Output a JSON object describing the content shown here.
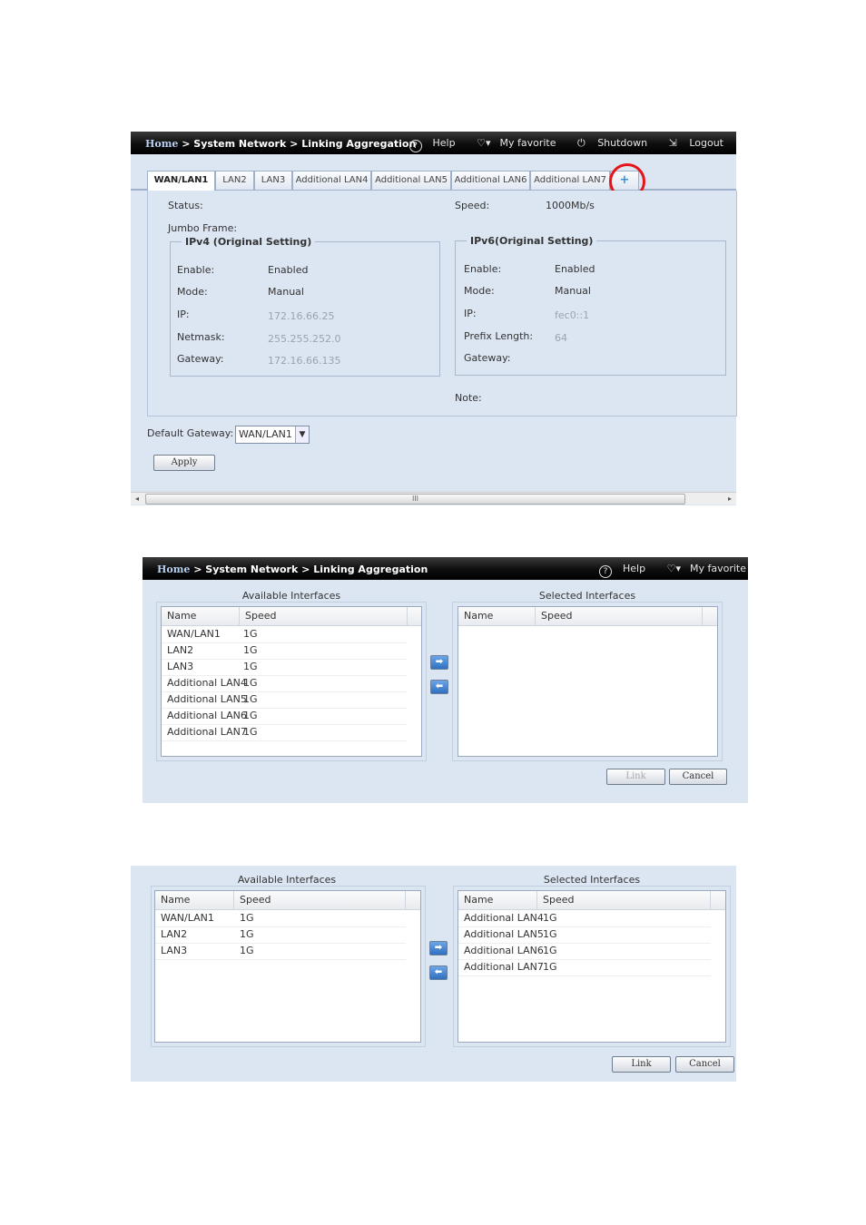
{
  "shot1": {
    "breadcrumb": {
      "home": "Home",
      "sep1": " > ",
      "section": "System Network",
      "sep2": " > ",
      "page": "Linking Aggregation"
    },
    "tools": {
      "help": "Help",
      "favorite": "My favorite",
      "shutdown": "Shutdown",
      "logout": "Logout"
    },
    "tabs": [
      "WAN/LAN1",
      "LAN2",
      "LAN3",
      "Additional LAN4",
      "Additional LAN5",
      "Additional LAN6",
      "Additional LAN7"
    ],
    "add_tab": "+",
    "status_label": "Status:",
    "speed_label": "Speed:",
    "speed_value": "1000Mb/s",
    "jumbo_label": "Jumbo Frame:",
    "ipv4": {
      "title": "IPv4 (Original Setting)",
      "enable_label": "Enable:",
      "enable_value": "Enabled",
      "mode_label": "Mode:",
      "mode_value": "Manual",
      "ip_label": "IP:",
      "ip_value": "172.16.66.25",
      "netmask_label": "Netmask:",
      "netmask_value": "255.255.252.0",
      "gateway_label": "Gateway:",
      "gateway_value": "172.16.66.135"
    },
    "ipv6": {
      "title": "IPv6(Original Setting)",
      "enable_label": "Enable:",
      "enable_value": "Enabled",
      "mode_label": "Mode:",
      "mode_value": "Manual",
      "ip_label": "IP:",
      "ip_value": "fec0::1",
      "prefix_label": "Prefix Length:",
      "prefix_value": "64",
      "gateway_label": "Gateway:"
    },
    "note_label": "Note:",
    "default_gateway_label": "Default Gateway:",
    "default_gateway_value": "WAN/LAN1",
    "apply": "Apply",
    "scroll_grip": "III"
  },
  "shot2": {
    "breadcrumb": {
      "home": "Home",
      "sep1": " > ",
      "section": "System Network",
      "sep2": " > ",
      "page": "Linking Aggregation"
    },
    "tools": {
      "help": "Help",
      "favorite": "My favorite"
    },
    "available_title": "Available Interfaces",
    "selected_title": "Selected Interfaces",
    "col_name": "Name",
    "col_speed": "Speed",
    "available": [
      {
        "name": "WAN/LAN1",
        "speed": "1G"
      },
      {
        "name": "LAN2",
        "speed": "1G"
      },
      {
        "name": "LAN3",
        "speed": "1G"
      },
      {
        "name": "Additional LAN4",
        "speed": "1G"
      },
      {
        "name": "Additional LAN5",
        "speed": "1G"
      },
      {
        "name": "Additional LAN6",
        "speed": "1G"
      },
      {
        "name": "Additional LAN7",
        "speed": "1G"
      }
    ],
    "selected": [],
    "link": "Link",
    "cancel": "Cancel"
  },
  "shot3": {
    "available_title": "Available Interfaces",
    "selected_title": "Selected Interfaces",
    "col_name": "Name",
    "col_speed": "Speed",
    "available": [
      {
        "name": "WAN/LAN1",
        "speed": "1G"
      },
      {
        "name": "LAN2",
        "speed": "1G"
      },
      {
        "name": "LAN3",
        "speed": "1G"
      }
    ],
    "selected": [
      {
        "name": "Additional LAN4",
        "speed": "1G"
      },
      {
        "name": "Additional LAN5",
        "speed": "1G"
      },
      {
        "name": "Additional LAN6",
        "speed": "1G"
      },
      {
        "name": "Additional LAN7",
        "speed": "1G"
      }
    ],
    "link": "Link",
    "cancel": "Cancel"
  },
  "colors": {
    "panel_bg": "#dce6f3",
    "header_bg": "#000000",
    "highlight_ring": "#e8121b",
    "accent": "#3c8de0"
  }
}
